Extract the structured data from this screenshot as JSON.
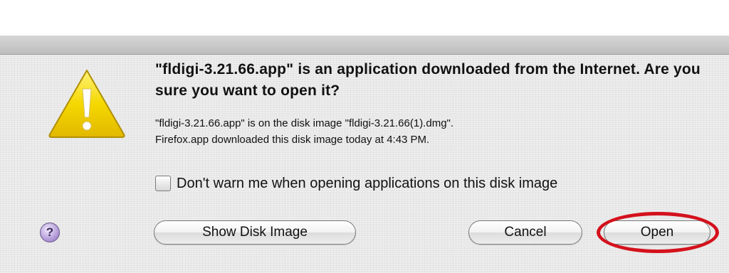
{
  "dialog": {
    "headline": "\"fldigi-3.21.66.app\" is an application downloaded from the Internet. Are you sure you want to open it?",
    "info_line1": "\"fldigi-3.21.66.app\" is on the disk image \"fldigi-3.21.66(1).dmg\".",
    "info_line2": "Firefox.app downloaded this disk image today at 4:43 PM.",
    "checkbox_label": "Don't warn me when opening applications on this disk image",
    "checkbox_checked": false,
    "help_symbol": "?",
    "buttons": {
      "show_disk_image": "Show Disk Image",
      "cancel": "Cancel",
      "open": "Open"
    },
    "icons": {
      "alert": "warning-triangle-icon",
      "help": "help-icon"
    },
    "colors": {
      "warning_yellow": "#f5d800",
      "highlight_red": "#d4111c",
      "help_purple": "#a98fd2"
    }
  }
}
